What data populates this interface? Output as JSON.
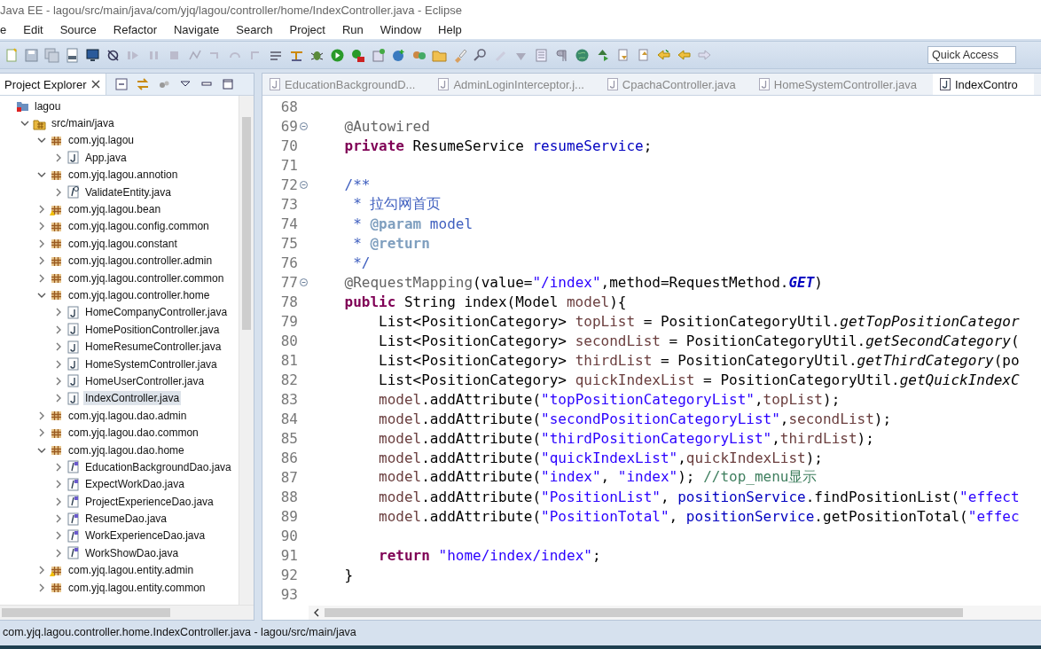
{
  "window": {
    "title": "Java EE - lagou/src/main/java/com/yjq/lagou/controller/home/IndexController.java - Eclipse"
  },
  "menu": [
    "e",
    "Edit",
    "Source",
    "Refactor",
    "Navigate",
    "Search",
    "Project",
    "Run",
    "Window",
    "Help"
  ],
  "quick_access": {
    "placeholder": "Quick Access"
  },
  "explorer": {
    "title": "Project Explorer",
    "tree": [
      {
        "label": "lagou",
        "kind": "project",
        "selected": false,
        "children": [
          {
            "label": "src/main/java",
            "kind": "source-folder",
            "expanded": true,
            "selected": false,
            "children": [
              {
                "label": "com.yjq.lagou",
                "kind": "package",
                "expanded": true,
                "selected": false,
                "children": [
                  {
                    "label": "App.java",
                    "kind": "class",
                    "expanded": false,
                    "selected": false
                  }
                ]
              },
              {
                "label": "com.yjq.lagou.annotion",
                "kind": "package",
                "expanded": true,
                "selected": false,
                "children": [
                  {
                    "label": "ValidateEntity.java",
                    "kind": "annotation",
                    "expanded": false,
                    "selected": false
                  }
                ]
              },
              {
                "label": "com.yjq.lagou.bean",
                "kind": "package-warning",
                "expanded": false,
                "selected": false
              },
              {
                "label": "com.yjq.lagou.config.common",
                "kind": "package",
                "expanded": false,
                "selected": false
              },
              {
                "label": "com.yjq.lagou.constant",
                "kind": "package",
                "expanded": false,
                "selected": false
              },
              {
                "label": "com.yjq.lagou.controller.admin",
                "kind": "package",
                "expanded": false,
                "selected": false
              },
              {
                "label": "com.yjq.lagou.controller.common",
                "kind": "package",
                "expanded": false,
                "selected": false
              },
              {
                "label": "com.yjq.lagou.controller.home",
                "kind": "package",
                "expanded": true,
                "selected": false,
                "children": [
                  {
                    "label": "HomeCompanyController.java",
                    "kind": "class",
                    "expanded": false,
                    "selected": false
                  },
                  {
                    "label": "HomePositionController.java",
                    "kind": "class",
                    "expanded": false,
                    "selected": false
                  },
                  {
                    "label": "HomeResumeController.java",
                    "kind": "class",
                    "expanded": false,
                    "selected": false
                  },
                  {
                    "label": "HomeSystemController.java",
                    "kind": "class",
                    "expanded": false,
                    "selected": false
                  },
                  {
                    "label": "HomeUserController.java",
                    "kind": "class",
                    "expanded": false,
                    "selected": false
                  },
                  {
                    "label": "IndexController.java",
                    "kind": "class",
                    "expanded": false,
                    "selected": true
                  }
                ]
              },
              {
                "label": "com.yjq.lagou.dao.admin",
                "kind": "package",
                "expanded": false,
                "selected": false
              },
              {
                "label": "com.yjq.lagou.dao.common",
                "kind": "package",
                "expanded": false,
                "selected": false
              },
              {
                "label": "com.yjq.lagou.dao.home",
                "kind": "package",
                "expanded": true,
                "selected": false,
                "children": [
                  {
                    "label": "EducationBackgroundDao.java",
                    "kind": "interface",
                    "expanded": false,
                    "selected": false
                  },
                  {
                    "label": "ExpectWorkDao.java",
                    "kind": "interface",
                    "expanded": false,
                    "selected": false
                  },
                  {
                    "label": "ProjectExperienceDao.java",
                    "kind": "interface",
                    "expanded": false,
                    "selected": false
                  },
                  {
                    "label": "ResumeDao.java",
                    "kind": "interface",
                    "expanded": false,
                    "selected": false
                  },
                  {
                    "label": "WorkExperienceDao.java",
                    "kind": "interface",
                    "expanded": false,
                    "selected": false
                  },
                  {
                    "label": "WorkShowDao.java",
                    "kind": "interface",
                    "expanded": false,
                    "selected": false
                  }
                ]
              },
              {
                "label": "com.yjq.lagou.entity.admin",
                "kind": "package-warning",
                "expanded": false,
                "selected": false
              },
              {
                "label": "com.yjq.lagou.entity.common",
                "kind": "package",
                "expanded": false,
                "selected": false
              }
            ]
          }
        ]
      }
    ]
  },
  "editor": {
    "tabs": [
      {
        "label": "EducationBackgroundD...",
        "selected": false
      },
      {
        "label": "AdminLoginInterceptor.j...",
        "selected": false
      },
      {
        "label": "CpachaController.java",
        "selected": false
      },
      {
        "label": "HomeSystemController.java",
        "selected": false
      },
      {
        "label": "IndexContro",
        "selected": true
      }
    ],
    "lines": [
      {
        "number": "68",
        "fold": false
      },
      {
        "number": "69",
        "fold": true,
        "tokens": [
          {
            "kind": "annotation",
            "text": "    @Autowired"
          }
        ]
      },
      {
        "number": "70",
        "fold": false,
        "tokens": [
          {
            "kind": "keyword",
            "text": "    private"
          },
          {
            "kind": "plain",
            "text": " ResumeService "
          },
          {
            "kind": "field",
            "text": "resumeService"
          },
          {
            "kind": "plain",
            "text": ";"
          }
        ]
      },
      {
        "number": "71",
        "fold": false
      },
      {
        "number": "72",
        "fold": true,
        "tokens": [
          {
            "kind": "javadoc",
            "text": "    /**"
          }
        ]
      },
      {
        "number": "73",
        "fold": false,
        "tokens": [
          {
            "kind": "javadoc",
            "text": "     * 拉勾网首页"
          }
        ]
      },
      {
        "number": "74",
        "fold": false,
        "tokens": [
          {
            "kind": "javadoc",
            "text": "     * "
          },
          {
            "kind": "doctag",
            "text": "@param"
          },
          {
            "kind": "javadoc",
            "text": " model"
          }
        ]
      },
      {
        "number": "75",
        "fold": false,
        "tokens": [
          {
            "kind": "javadoc",
            "text": "     * "
          },
          {
            "kind": "doctag",
            "text": "@return"
          }
        ]
      },
      {
        "number": "76",
        "fold": false,
        "tokens": [
          {
            "kind": "javadoc",
            "text": "     */"
          }
        ]
      },
      {
        "number": "77",
        "fold": true,
        "tokens": [
          {
            "kind": "annotation",
            "text": "    @RequestMapping"
          },
          {
            "kind": "plain",
            "text": "(value="
          },
          {
            "kind": "string",
            "text": "\"/index\""
          },
          {
            "kind": "plain",
            "text": ",method=RequestMethod."
          },
          {
            "kind": "constant",
            "text": "GET"
          },
          {
            "kind": "plain",
            "text": ")"
          }
        ]
      },
      {
        "number": "78",
        "fold": false,
        "tokens": [
          {
            "kind": "keyword",
            "text": "    public"
          },
          {
            "kind": "plain",
            "text": " String index(Model "
          },
          {
            "kind": "local",
            "text": "model"
          },
          {
            "kind": "plain",
            "text": "){"
          }
        ]
      },
      {
        "number": "79",
        "fold": false,
        "tokens": [
          {
            "kind": "plain",
            "text": "        List<PositionCategory> "
          },
          {
            "kind": "local",
            "text": "topList"
          },
          {
            "kind": "plain",
            "text": " = PositionCategoryUtil."
          },
          {
            "kind": "static",
            "text": "getTopPositionCategor"
          }
        ]
      },
      {
        "number": "80",
        "fold": false,
        "tokens": [
          {
            "kind": "plain",
            "text": "        List<PositionCategory> "
          },
          {
            "kind": "local",
            "text": "secondList"
          },
          {
            "kind": "plain",
            "text": " = PositionCategoryUtil."
          },
          {
            "kind": "static",
            "text": "getSecondCategory"
          },
          {
            "kind": "plain",
            "text": "("
          }
        ]
      },
      {
        "number": "81",
        "fold": false,
        "tokens": [
          {
            "kind": "plain",
            "text": "        List<PositionCategory> "
          },
          {
            "kind": "local",
            "text": "thirdList"
          },
          {
            "kind": "plain",
            "text": " = PositionCategoryUtil."
          },
          {
            "kind": "static",
            "text": "getThirdCategory"
          },
          {
            "kind": "plain",
            "text": "(po"
          }
        ]
      },
      {
        "number": "82",
        "fold": false,
        "tokens": [
          {
            "kind": "plain",
            "text": "        List<PositionCategory> "
          },
          {
            "kind": "local",
            "text": "quickIndexList"
          },
          {
            "kind": "plain",
            "text": " = PositionCategoryUtil."
          },
          {
            "kind": "static",
            "text": "getQuickIndexC"
          }
        ]
      },
      {
        "number": "83",
        "fold": false,
        "tokens": [
          {
            "kind": "local",
            "text": "        model"
          },
          {
            "kind": "plain",
            "text": ".addAttribute("
          },
          {
            "kind": "string",
            "text": "\"topPositionCategoryList\""
          },
          {
            "kind": "plain",
            "text": ","
          },
          {
            "kind": "local",
            "text": "topList"
          },
          {
            "kind": "plain",
            "text": ");"
          }
        ]
      },
      {
        "number": "84",
        "fold": false,
        "tokens": [
          {
            "kind": "local",
            "text": "        model"
          },
          {
            "kind": "plain",
            "text": ".addAttribute("
          },
          {
            "kind": "string",
            "text": "\"secondPositionCategoryList\""
          },
          {
            "kind": "plain",
            "text": ","
          },
          {
            "kind": "local",
            "text": "secondList"
          },
          {
            "kind": "plain",
            "text": ");"
          }
        ]
      },
      {
        "number": "85",
        "fold": false,
        "tokens": [
          {
            "kind": "local",
            "text": "        model"
          },
          {
            "kind": "plain",
            "text": ".addAttribute("
          },
          {
            "kind": "string",
            "text": "\"thirdPositionCategoryList\""
          },
          {
            "kind": "plain",
            "text": ","
          },
          {
            "kind": "local",
            "text": "thirdList"
          },
          {
            "kind": "plain",
            "text": ");"
          }
        ]
      },
      {
        "number": "86",
        "fold": false,
        "tokens": [
          {
            "kind": "local",
            "text": "        model"
          },
          {
            "kind": "plain",
            "text": ".addAttribute("
          },
          {
            "kind": "string",
            "text": "\"quickIndexList\""
          },
          {
            "kind": "plain",
            "text": ","
          },
          {
            "kind": "local",
            "text": "quickIndexList"
          },
          {
            "kind": "plain",
            "text": ");"
          }
        ]
      },
      {
        "number": "87",
        "fold": false,
        "tokens": [
          {
            "kind": "local",
            "text": "        model"
          },
          {
            "kind": "plain",
            "text": ".addAttribute("
          },
          {
            "kind": "string",
            "text": "\"index\""
          },
          {
            "kind": "plain",
            "text": ", "
          },
          {
            "kind": "string",
            "text": "\"index\""
          },
          {
            "kind": "plain",
            "text": "); "
          },
          {
            "kind": "comment",
            "text": "//top_menu显示"
          }
        ]
      },
      {
        "number": "88",
        "fold": false,
        "tokens": [
          {
            "kind": "local",
            "text": "        model"
          },
          {
            "kind": "plain",
            "text": ".addAttribute("
          },
          {
            "kind": "string",
            "text": "\"PositionList\""
          },
          {
            "kind": "plain",
            "text": ", "
          },
          {
            "kind": "field",
            "text": "positionService"
          },
          {
            "kind": "plain",
            "text": ".findPositionList("
          },
          {
            "kind": "string",
            "text": "\"effect"
          }
        ]
      },
      {
        "number": "89",
        "fold": false,
        "tokens": [
          {
            "kind": "local",
            "text": "        model"
          },
          {
            "kind": "plain",
            "text": ".addAttribute("
          },
          {
            "kind": "string",
            "text": "\"PositionTotal\""
          },
          {
            "kind": "plain",
            "text": ", "
          },
          {
            "kind": "field",
            "text": "positionService"
          },
          {
            "kind": "plain",
            "text": ".getPositionTotal("
          },
          {
            "kind": "string",
            "text": "\"effec"
          }
        ]
      },
      {
        "number": "90",
        "fold": false
      },
      {
        "number": "91",
        "fold": false,
        "tokens": [
          {
            "kind": "keyword",
            "text": "        return "
          },
          {
            "kind": "string",
            "text": "\"home/index/index\""
          },
          {
            "kind": "plain",
            "text": ";"
          }
        ]
      },
      {
        "number": "92",
        "fold": false,
        "tokens": [
          {
            "kind": "plain",
            "text": "    }"
          }
        ]
      },
      {
        "number": "93",
        "fold": false
      }
    ]
  },
  "status_bar": {
    "text": "com.yjq.lagou.controller.home.IndexController.java - lagou/src/main/java"
  }
}
